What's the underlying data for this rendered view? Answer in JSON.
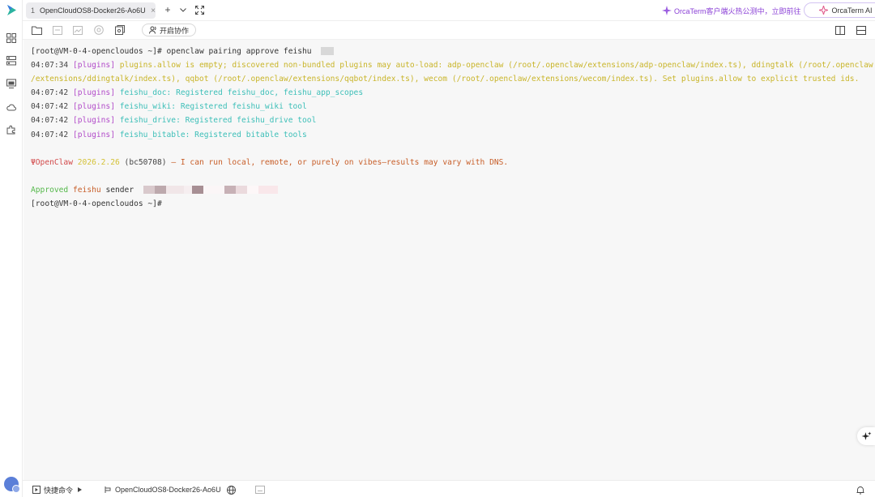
{
  "tabs": [
    {
      "number": "1",
      "title": "OpenCloudOS8-Docker26-Ao6U",
      "close": "×"
    }
  ],
  "tabbar": {
    "new_tab": "+",
    "dropdown": "⌄",
    "promo_text": "OrcaTerm客户端火热公测中，立即前往",
    "ai_button_label": "OrcaTerm AI"
  },
  "toolbar": {
    "collab_label": "开启协作"
  },
  "terminal": {
    "prompt": "[root@VM-0-4-opencloudos ~]# ",
    "command": "openclaw pairing approve feishu",
    "logs": [
      {
        "time": "04:07:34",
        "tag": "[plugins]",
        "message": "plugins.allow is empty; discovered non-bundled plugins may auto-load: adp-openclaw (/root/.openclaw/extensions/adp-openclaw/index.ts), ddingtalk (/root/.openclaw",
        "cont": "/extensions/ddingtalk/index.ts), qqbot (/root/.openclaw/extensions/qqbot/index.ts), wecom (/root/.openclaw/extensions/wecom/index.ts). Set plugins.allow to explicit trusted ids."
      },
      {
        "time": "04:07:42",
        "tag": "[plugins]",
        "message": "feishu_doc: Registered feishu_doc, feishu_app_scopes"
      },
      {
        "time": "04:07:42",
        "tag": "[plugins]",
        "message": "feishu_wiki: Registered feishu_wiki tool"
      },
      {
        "time": "04:07:42",
        "tag": "[plugins]",
        "message": "feishu_drive: Registered feishu_drive tool"
      },
      {
        "time": "04:07:42",
        "tag": "[plugins]",
        "message": "feishu_bitable: Registered bitable tools"
      }
    ],
    "banner": {
      "icon": "Ψ",
      "name": "OpenClaw",
      "version": "2026.2.26",
      "build": "(bc50708)",
      "tagline": "— I can run local, remote, or purely on vibes—results may vary with DNS."
    },
    "approved": {
      "word": "Approved",
      "channel": "feishu",
      "rest": "sender"
    },
    "final_prompt": "[root@VM-0-4-opencloudos ~]#"
  },
  "statusbar": {
    "quick_commands": "快捷命令",
    "session_name": "OpenCloudOS8-Docker26-Ao6U"
  },
  "icons": {
    "logo": "orcaterm-logo-icon",
    "rail": [
      "apps-grid-icon",
      "server-list-icon",
      "monitor-icon",
      "cloud-icon",
      "plugin-icon"
    ],
    "toolbar": [
      "open-folder-icon",
      "upload-icon",
      "image-icon",
      "record-icon",
      "snapshot-icon"
    ]
  },
  "colors": {
    "timestamp": "#444444",
    "plugins_tag": "#b24cc9",
    "warning": "#c9b52a",
    "info": "#3dbfb8",
    "openclaw_red": "#d2494a",
    "approved_green": "#55b84b",
    "promo_purple": "#8a3fd6"
  }
}
